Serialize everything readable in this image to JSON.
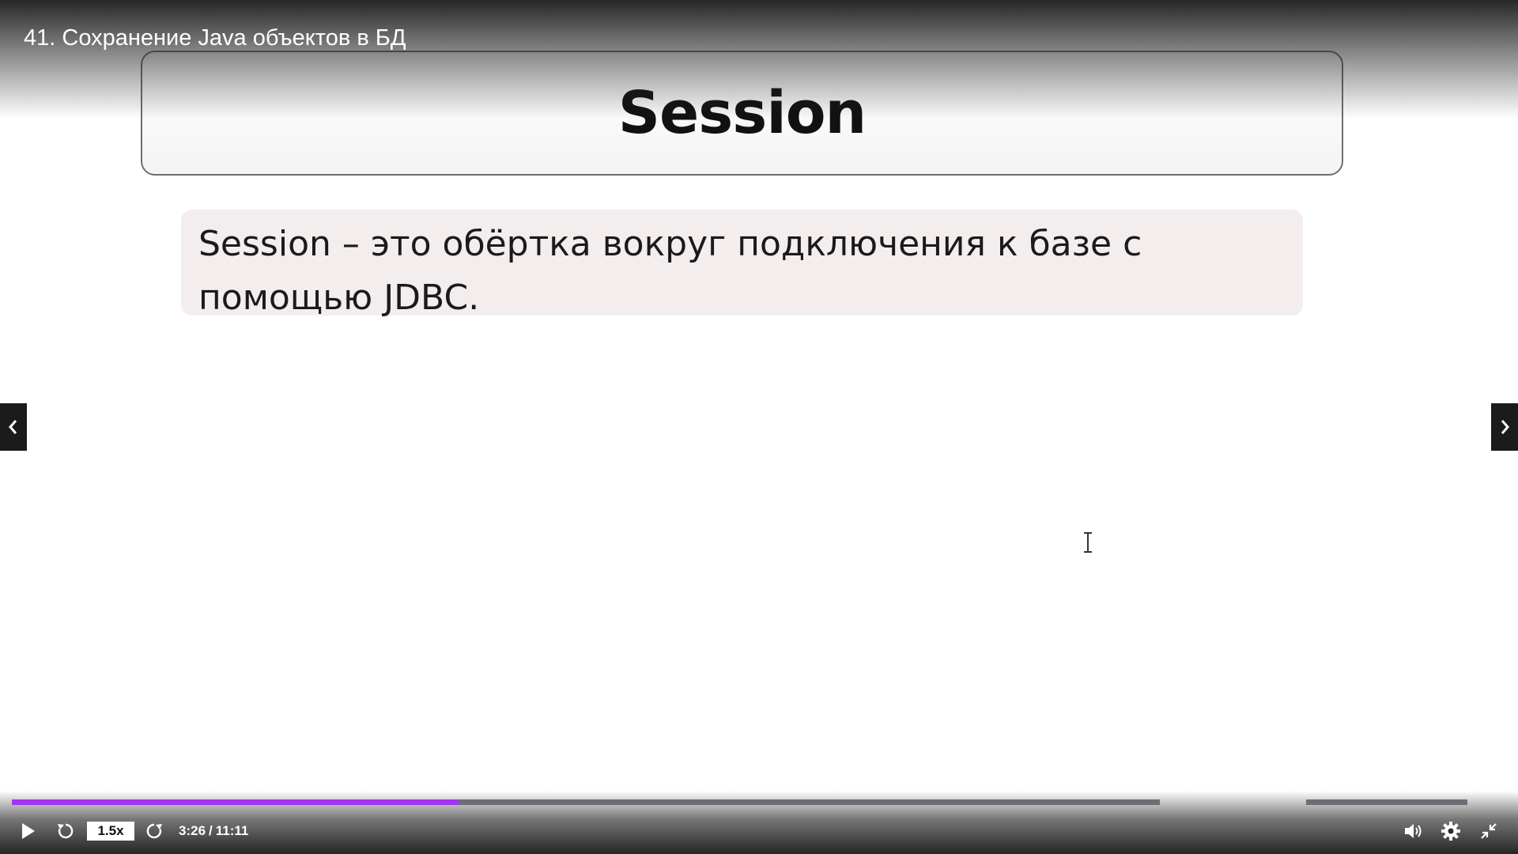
{
  "lecture": {
    "title": "41. Сохранение Java объектов в БД"
  },
  "slide": {
    "heading": "Session",
    "definition": "Session – это обёртка вокруг подключения к базе с помощью JDBC."
  },
  "navigation": {
    "prev_icon": "chevron-left-icon",
    "next_icon": "chevron-right-icon"
  },
  "player": {
    "speed": "1.5x",
    "current_time": "3:26",
    "separator": "/",
    "duration": "11:11",
    "progress_fraction": 0.307,
    "accent_color": "#a435f0",
    "icons": [
      "play-icon",
      "rewind-icon",
      "forward-icon",
      "volume-icon",
      "settings-icon",
      "exit-fullscreen-icon"
    ]
  }
}
